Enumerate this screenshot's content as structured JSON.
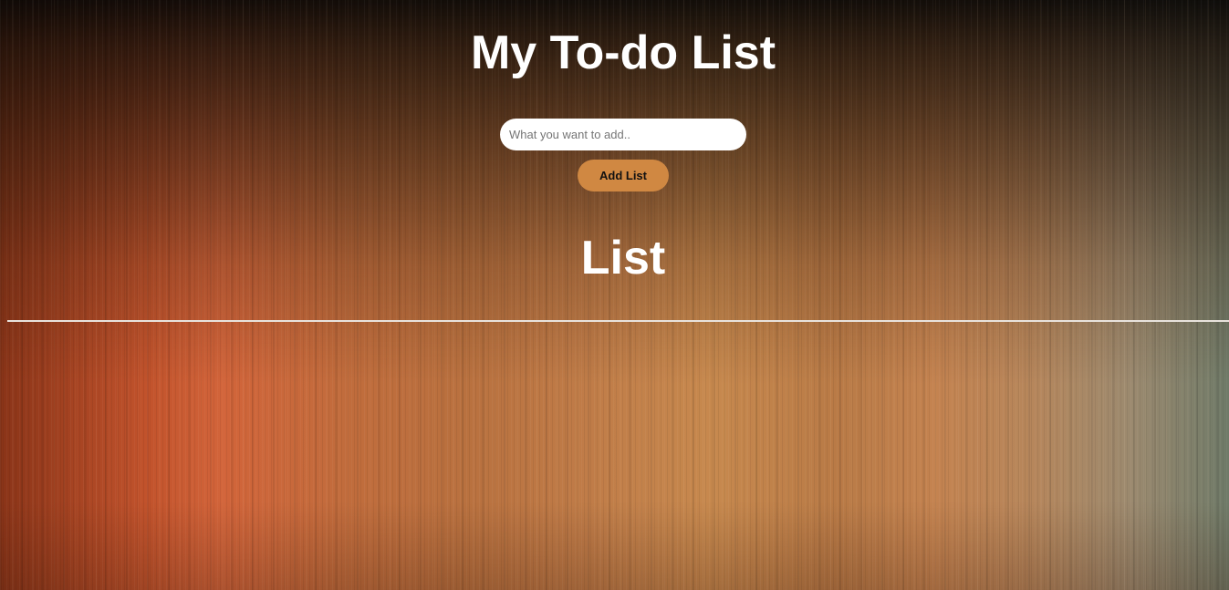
{
  "header": {
    "title": "My To-do List"
  },
  "form": {
    "input_value": "",
    "input_placeholder": "What you want to add..",
    "add_button_label": "Add List"
  },
  "list": {
    "heading": "List",
    "items": []
  },
  "colors": {
    "button_background": "#d08842",
    "text": "#ffffff",
    "input_background": "#ffffff"
  }
}
